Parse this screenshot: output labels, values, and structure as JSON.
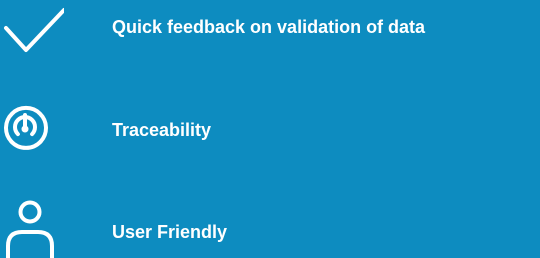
{
  "features": [
    {
      "icon": "checkmark-icon",
      "label": "Quick feedback on validation of data"
    },
    {
      "icon": "radar-target-icon",
      "label": "Traceability"
    },
    {
      "icon": "user-icon",
      "label": "User Friendly"
    }
  ],
  "colors": {
    "background": "#0d8cc0",
    "text": "#ffffff",
    "icon": "#ffffff"
  }
}
